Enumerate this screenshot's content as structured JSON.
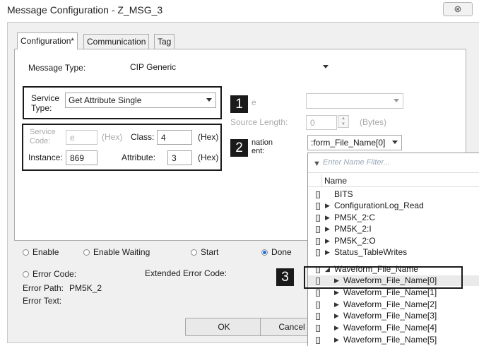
{
  "window": {
    "title": "Message Configuration - Z_MSG_3",
    "close_symbol": "⊗"
  },
  "tabs": [
    "Configuration*",
    "Communication",
    "Tag"
  ],
  "config": {
    "message_type_label": "Message Type:",
    "message_type_value": "CIP Generic",
    "service_type_label_1": "Service",
    "service_type_label_2": "Type:",
    "service_type_value": "Get Attribute Single",
    "service_code_label_1": "Service",
    "service_code_label_2": "Code:",
    "service_code_value": "e",
    "hex_1": "(Hex)",
    "class_label": "Class:",
    "class_value": "4",
    "hex_2": "(Hex)",
    "instance_label": "Instance:",
    "instance_value": "869",
    "attribute_label": "Attribute:",
    "attribute_value": "3",
    "hex_3": "(Hex)",
    "source_frag": "e",
    "source_length_label": "Source Length:",
    "source_length_value": "0",
    "bytes_label": "(Bytes)",
    "dest_frag_1": "nation",
    "dest_frag_2": "ent:",
    "dest_value": ":form_File_Name[0]"
  },
  "callouts": [
    "1",
    "2",
    "3"
  ],
  "status": {
    "enable": "Enable",
    "enable_waiting": "Enable Waiting",
    "start": "Start",
    "done": "Done",
    "error_code": "Error Code:",
    "extended_error_code": "Extended Error Code:",
    "error_path_label": "Error Path:",
    "error_path_value": "PM5K_2",
    "error_text": "Error Text:"
  },
  "buttons": {
    "ok": "OK",
    "cancel": "Cancel"
  },
  "tag_browser": {
    "filter_placeholder": "Enter Name Filter...",
    "column_header": "Name",
    "rows": [
      {
        "name": "BITS",
        "expander": ""
      },
      {
        "name": "ConfigurationLog_Read",
        "expander": "▶"
      },
      {
        "name": "PM5K_2:C",
        "expander": "▶"
      },
      {
        "name": "PM5K_2:I",
        "expander": "▶"
      },
      {
        "name": "PM5K_2:O",
        "expander": "▶"
      },
      {
        "name": "Status_TableWrites",
        "expander": "▶"
      },
      {
        "name": "Waveform_File_Name",
        "expander": "◢"
      },
      {
        "name": "Waveform_File_Name[0]",
        "expander": "▶"
      },
      {
        "name": "Waveform_File_Name[1]",
        "expander": "▶"
      },
      {
        "name": "Waveform_File_Name[2]",
        "expander": "▶"
      },
      {
        "name": "Waveform_File_Name[3]",
        "expander": "▶"
      },
      {
        "name": "Waveform_File_Name[4]",
        "expander": "▶"
      },
      {
        "name": "Waveform_File_Name[5]",
        "expander": "▶"
      }
    ]
  }
}
